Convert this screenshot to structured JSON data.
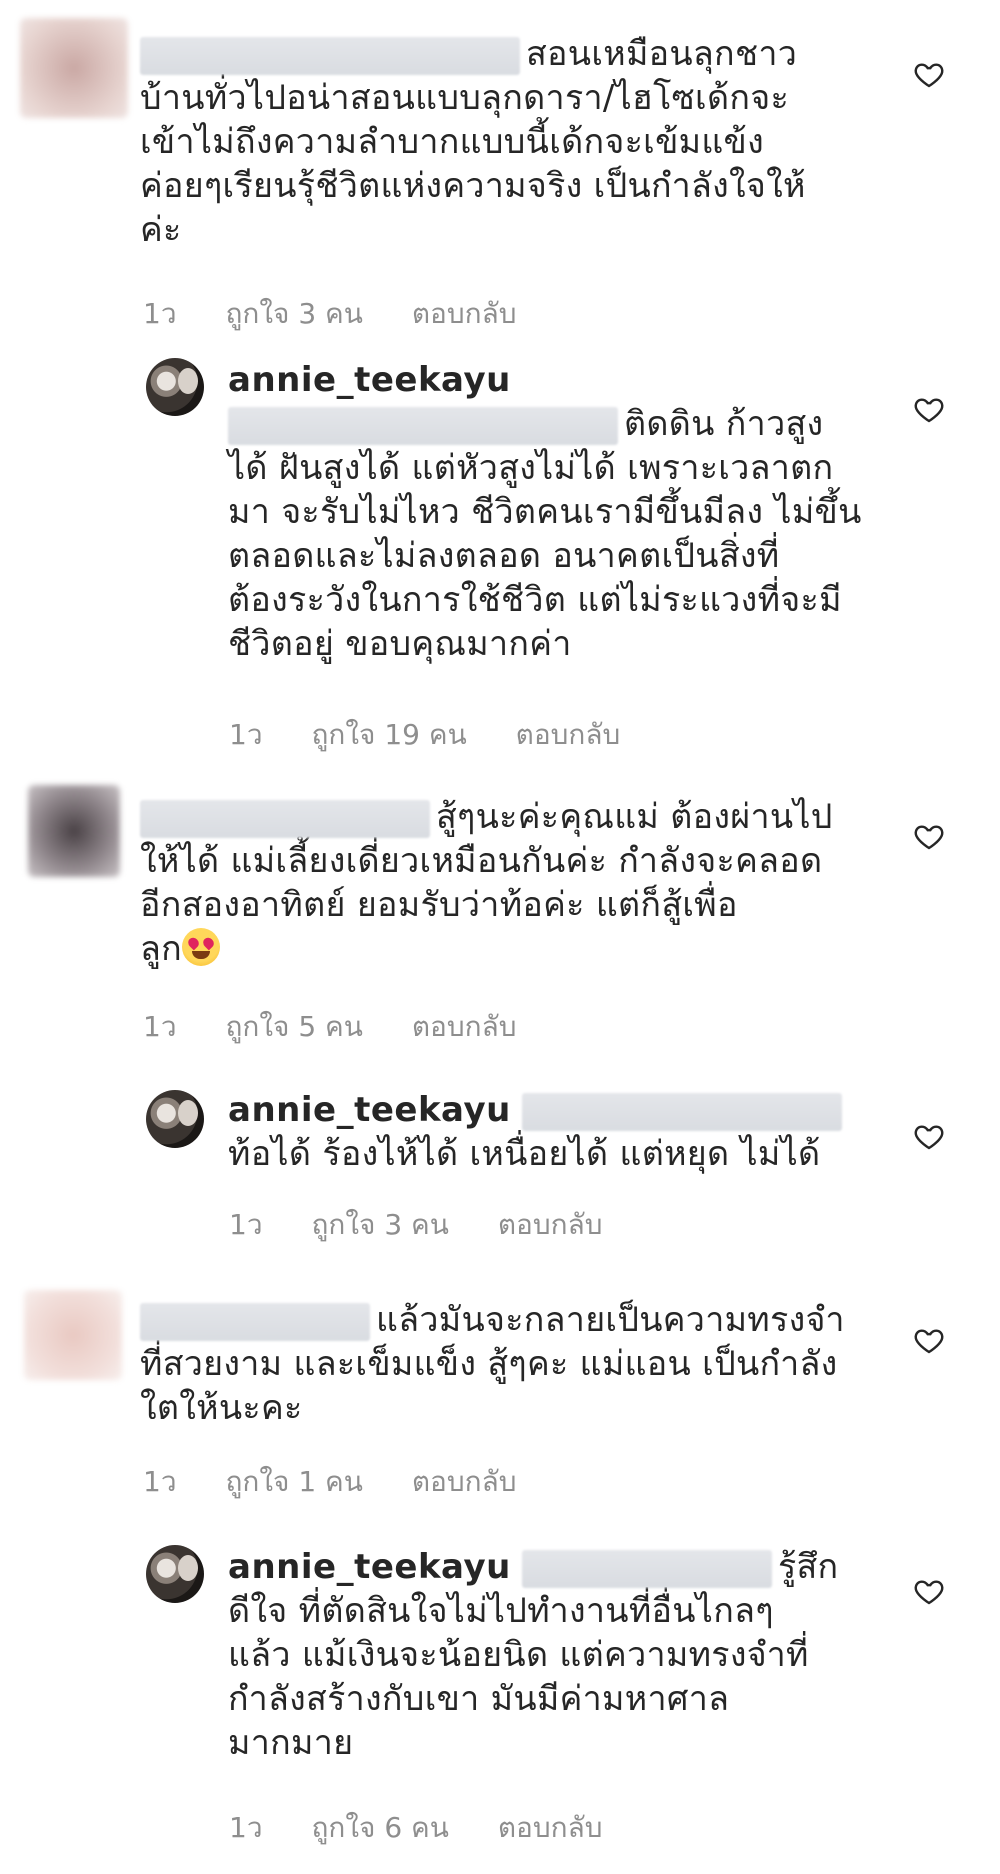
{
  "colors": {
    "text": "#262626",
    "meta": "#8e8e8e",
    "redaction": "#dcdfe4"
  },
  "comments": [
    {
      "lines": [
        "สอนเหมือนลุกชาว",
        "บ้านทั่วไปอน่าสอนแบบลุกดารา/ไฮโซเด้กจะ",
        "เข้าไม่ถึงความลำบากแบบนี้เด้กจะเข้มแข้ง",
        "ค่อยๆเรียนรุ้ชีวิตแห่งความจริง เป็นกำลังใจให้",
        "ค่ะ"
      ],
      "time": "1ว",
      "likes": "ถูกใจ 3 คน",
      "reply": "ตอบกลับ",
      "icon": "heart-outline-icon"
    },
    {
      "username": "annie_teekayu",
      "lines": [
        "ติดดิน ก้าวสูง",
        "ได้ ฝันสูงได้ แต่หัวสูงไม่ได้ เพราะเวลาตก",
        "มา จะรับไม่ไหว ชีวิตคนเรามีขึ้นมีลง ไม่ขึ้น",
        "ตลอดและไม่ลงตลอด อนาคตเป็นสิ่งที่",
        "ต้องระวังในการใช้ชีวิต แต่ไม่ระแวงที่จะมี",
        "ชีวิตอยู่ ขอบคุณมากค่า"
      ],
      "time": "1ว",
      "likes": "ถูกใจ 19 คน",
      "reply": "ตอบกลับ",
      "icon": "heart-outline-icon"
    },
    {
      "lines": [
        "สู้ๆนะค่ะคุณแม่ ต้องผ่านไป",
        "ให้ได้ แม่เลี้ยงเดี่ยวเหมือนกันค่ะ กำลังจะคลอด",
        "อีกสองอาทิตย์ ยอมรับว่าท้อค่ะ แต่ก็สู้เพื่อ",
        "ลูก"
      ],
      "emoji": "heart-eyes-emoji",
      "time": "1ว",
      "likes": "ถูกใจ 5 คน",
      "reply": "ตอบกลับ",
      "icon": "heart-outline-icon"
    },
    {
      "username": "annie_teekayu",
      "lines": [
        "ท้อได้ ร้องไห้ได้ เหนื่อยได้ แต่หยุด ไม่ได้"
      ],
      "time": "1ว",
      "likes": "ถูกใจ 3 คน",
      "reply": "ตอบกลับ",
      "icon": "heart-outline-icon"
    },
    {
      "lines": [
        "แล้วมันจะกลายเป็นความทรงจำ",
        "ที่สวยงาม และเข็มแข็ง สู้ๆคะ แม่แอน เป็นกำลัง",
        "ใตให้นะคะ"
      ],
      "time": "1ว",
      "likes": "ถูกใจ 1 คน",
      "reply": "ตอบกลับ",
      "icon": "heart-outline-icon"
    },
    {
      "username": "annie_teekayu",
      "lines": [
        "รู้สึก",
        "ดีใจ ที่ตัดสินใจไม่ไปทำงานที่อื่นไกลๆ",
        "แล้ว แม้เงินจะน้อยนิด แต่ความทรงจำที่",
        "กำลังสร้างกับเขา มันมีค่ามหาศาล",
        "มากมาย"
      ],
      "time": "1ว",
      "likes": "ถูกใจ 6 คน",
      "reply": "ตอบกลับ",
      "icon": "heart-outline-icon"
    }
  ]
}
